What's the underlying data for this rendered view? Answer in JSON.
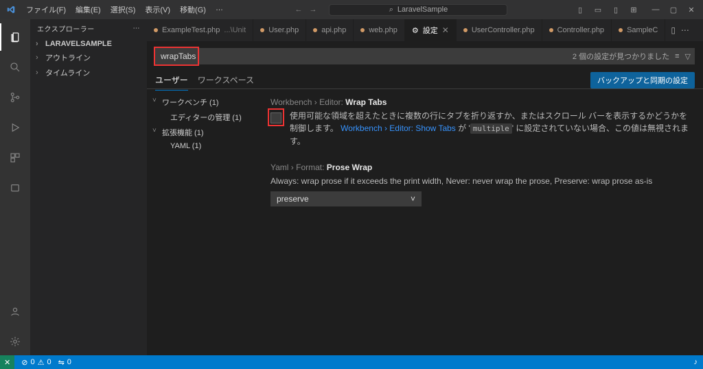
{
  "menu": {
    "file": "ファイル(F)",
    "edit": "編集(E)",
    "select": "選択(S)",
    "view": "表示(V)",
    "go": "移動(G)",
    "more": "…"
  },
  "titlebar": {
    "nav_back": "←",
    "nav_fwd": "→",
    "search_icon": "⌕",
    "search_text": "LaravelSample"
  },
  "layout_icons": [
    "▯",
    "▭",
    "▯",
    "⊞"
  ],
  "window": {
    "min": "—",
    "max": "▢",
    "close": "✕"
  },
  "sidebar": {
    "title": "エクスプローラー",
    "dots": "⋯",
    "sections": [
      "LARAVELSAMPLE",
      "アウトライン",
      "タイムライン"
    ]
  },
  "tabs": [
    {
      "label": "ExampleTest.php",
      "suffix": " ...\\Unit",
      "color": "#d19a66"
    },
    {
      "label": "User.php",
      "color": "#d19a66"
    },
    {
      "label": "api.php",
      "color": "#d19a66"
    },
    {
      "label": "web.php",
      "color": "#d19a66"
    },
    {
      "label": "設定",
      "gear": true,
      "active": true,
      "close": "✕"
    },
    {
      "label": "UserController.php",
      "color": "#d19a66"
    },
    {
      "label": "Controller.php",
      "color": "#d19a66"
    },
    {
      "label": "SampleC",
      "color": "#d19a66"
    }
  ],
  "tabctrl": {
    "split": "▯",
    "more": "⋯"
  },
  "settings": {
    "search_value": "wrapTabs",
    "results_msg": "2 個の設定が見つかりました",
    "filter_icon": "≡",
    "clear_icon": "▽",
    "scope_user": "ユーザー",
    "scope_ws": "ワークスペース",
    "sync_button": "バックアップと同期の設定",
    "tree": [
      {
        "label": "ワークベンチ (1)",
        "children": [
          "エディターの管理 (1)"
        ]
      },
      {
        "label": "拡張機能 (1)",
        "children": [
          "YAML (1)"
        ]
      }
    ],
    "item1": {
      "cat": "Workbench › Editor:",
      "name": "Wrap Tabs",
      "desc_a": "使用可能な領域を超えたときに複数の行にタブを折り返すか、またはスクロール バーを表示するかどうかを制御します。",
      "link": "Workbench › Editor: Show Tabs",
      "desc_b": " が ",
      "code": "multiple",
      "desc_c": " に設定されていない場合、この値は無視されます。"
    },
    "item2": {
      "cat": "Yaml › Format:",
      "name": "Prose Wrap",
      "desc": "Always: wrap prose if it exceeds the print width, Never: never wrap the prose, Preserve: wrap prose as-is",
      "value": "preserve",
      "chevron": "˅"
    }
  },
  "status": {
    "remote": "✕",
    "err_icon": "⊘",
    "err": "0",
    "warn_icon": "⚠",
    "warn": "0",
    "ports_icon": "⇋",
    "ports": "0",
    "bell": "♪"
  }
}
